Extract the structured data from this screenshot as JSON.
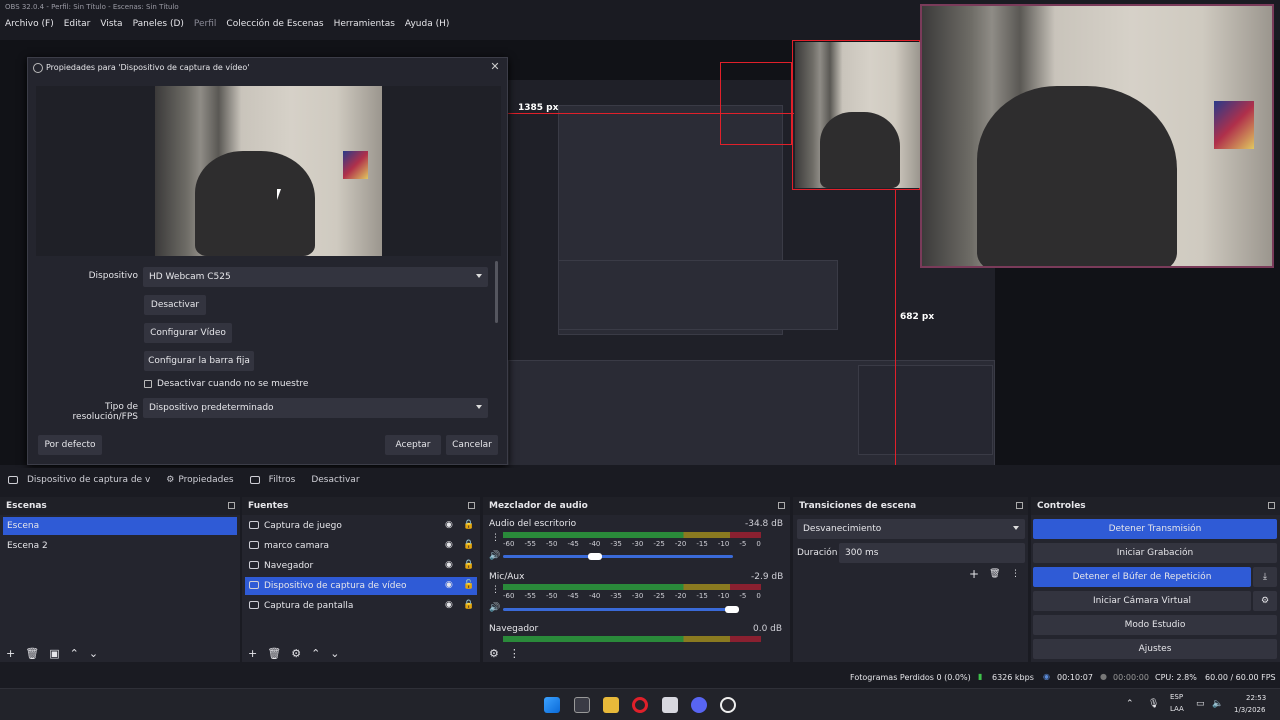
{
  "window": {
    "title": "OBS 32.0.4 - Perfil: Sin Título - Escenas: Sin Título"
  },
  "menu": {
    "items": [
      "Archivo (F)",
      "Editar",
      "Vista",
      "Paneles (D)",
      "Perfil",
      "Colección de Escenas",
      "Herramientas",
      "Ayuda (H)"
    ]
  },
  "preview": {
    "label_width": "1385 px",
    "label_height_top": "682 px",
    "label_height_mid": "682 px"
  },
  "dialog": {
    "title": "Propiedades para 'Dispositivo de captura de vídeo'",
    "device_label": "Dispositivo",
    "device_value": "HD Webcam C525",
    "deactivate": "Desactivar",
    "configure_video": "Configurar Vídeo",
    "configure_crossbar": "Configurar la barra fija",
    "checkbox_label": "Desactivar cuando no se muestre",
    "res_label": "Tipo de resolución/FPS",
    "res_value": "Dispositivo predeterminado",
    "defaults": "Por defecto",
    "accept": "Aceptar",
    "cancel": "Cancelar"
  },
  "source_toolbar": {
    "source_name": "Dispositivo de captura de v",
    "properties": "Propiedades",
    "filters": "Filtros",
    "deactivate": "Desactivar"
  },
  "scenes": {
    "title": "Escenas",
    "items": [
      "Escena",
      "Escena 2"
    ]
  },
  "sources": {
    "title": "Fuentes",
    "items": [
      "Captura de juego",
      "marco camara",
      "Navegador",
      "Dispositivo de captura de vídeo",
      "Captura de pantalla"
    ]
  },
  "mixer": {
    "title": "Mezclador de audio",
    "channels": [
      {
        "name": "Audio del escritorio",
        "db": "-34.8 dB"
      },
      {
        "name": "Mic/Aux",
        "db": "-2.9 dB"
      },
      {
        "name": "Navegador",
        "db": "0.0 dB"
      }
    ],
    "ticks": [
      "-60",
      "-55",
      "-50",
      "-45",
      "-40",
      "-35",
      "-30",
      "-25",
      "-20",
      "-15",
      "-10",
      "-5",
      "0"
    ]
  },
  "transitions": {
    "title": "Transiciones de escena",
    "type": "Desvanecimiento",
    "duration_label": "Duración",
    "duration_value": "300 ms"
  },
  "controls": {
    "title": "Controles",
    "buttons": [
      "Detener Transmisión",
      "Iniciar Grabación",
      "Detener el Búfer de Repetición",
      "Iniciar Cámara Virtual",
      "Modo Estudio",
      "Ajustes"
    ]
  },
  "status": {
    "dropped": "Fotogramas Perdidos 0 (0.0%)",
    "bitrate": "6326 kbps",
    "stream_time": "00:10:07",
    "rec_time": "00:00:00",
    "cpu": "CPU: 2.8%",
    "fps": "60.00 / 60.00 FPS"
  },
  "taskbar": {
    "lang": "ESP",
    "layout": "LAA",
    "time": "22:53",
    "date": "1/3/2026"
  },
  "colors": {
    "accent": "#2f5bd6",
    "bg": "#1a1b22",
    "panel": "#24252e",
    "red": "#e0202a"
  }
}
